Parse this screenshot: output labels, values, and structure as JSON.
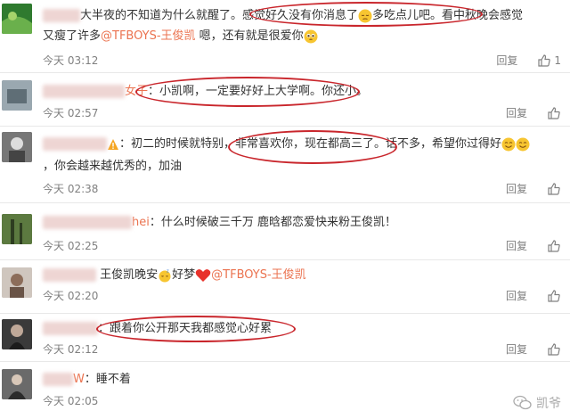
{
  "comments": [
    {
      "line1": "大半夜的不知道为什么就醒了。感觉好久没有你消息了",
      "line1b": "多吃点儿吧。看中秋晚会感觉",
      "line2a": "又瘦了许多",
      "mention": "@TFBOYS-王俊凯",
      "line2b": " 嗯，还有就是很爱你",
      "time": "今天 03:12",
      "reply": "回复",
      "likes": "1"
    },
    {
      "name": "女子",
      "text": "：小凯啊，一定要好好上大学啊。你还小。",
      "time": "今天 02:57",
      "reply": "回复",
      "likes": ""
    },
    {
      "text1": "：初二的时候就特别，非常喜欢你，现在都高三了。话不多，希望你过得好",
      "text2": "，你会越来越优秀的，加油",
      "time": "今天 02:38",
      "reply": "回复",
      "likes": ""
    },
    {
      "name": "hei",
      "text": "：什么时候破三千万   鹿晗都恋爱快来粉王俊凯！",
      "time": "今天 02:25",
      "reply": "回复",
      "likes": ""
    },
    {
      "text1": "王俊凯晚安",
      "text2": "好梦",
      "mention": "@TFBOYS-王俊凯",
      "time": "今天 02:20",
      "reply": "回复",
      "likes": ""
    },
    {
      "text": "：跟着你公开那天我都感觉心好累",
      "time": "今天 02:12",
      "reply": "回复",
      "likes": ""
    },
    {
      "name": "W",
      "text": "：睡不着",
      "time": "今天 02:05",
      "reply": "回复",
      "likes": ""
    }
  ],
  "watermark": "凯爷",
  "icons": [
    "thumbs-up-icon",
    "pensive-emoji",
    "pleading-emoji",
    "smile-emoji",
    "sleep-emoji",
    "heart-icon",
    "wechat-icon"
  ],
  "accent": "#eb7350",
  "circle_color": "#c9262c"
}
